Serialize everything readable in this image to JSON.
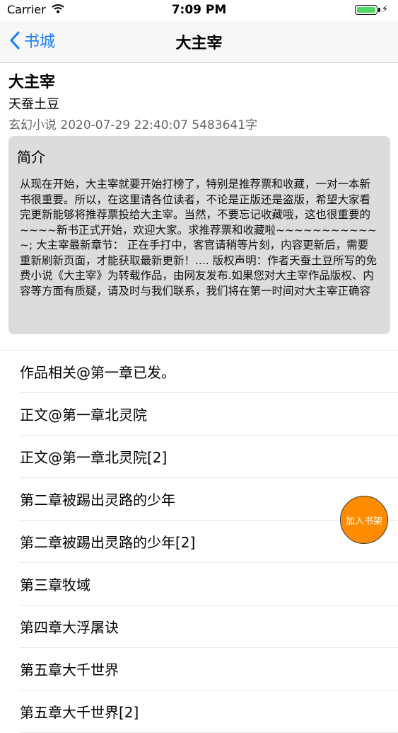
{
  "status_bar": {
    "carrier": "Carrier",
    "time": "7:09 PM",
    "battery_level": 1.0
  },
  "nav": {
    "back_label": "书城",
    "title": "大主宰"
  },
  "book": {
    "title": "大主宰",
    "author": "天蚕土豆",
    "meta": "玄幻小说 2020-07-29 22:40:07 5483641字"
  },
  "intro": {
    "heading": "简介",
    "text": "从现在开始，大主宰就要开始打榜了，特别是推荐票和收藏，一对一本新书很重要。所以，在这里请各位读者，不论是正版还是盗版，希望大家看完更新能够将推荐票投给大主宰。当然，不要忘记收藏哦，这也很重要的~~~~新书正式开始，欢迎大家。求推荐票和收藏啦~~~~~~~~~~~~; 大主宰最新章节： 正在手打中，客官请稍等片刻，内容更新后，需要重新刷新页面，才能获取最新更新！.... 版权声明：作者天蚕土豆所写的免费小说《大主宰》为转载作品，由网友发布.如果您对大主宰作品版权、内容等方面有质疑，请及时与我们联系，我们将在第一时间对大主宰正确容"
  },
  "chapters": [
    "作品相关@第一章已发。",
    "正文@第一章北灵院",
    "正文@第一章北灵院[2]",
    "第二章被踢出灵路的少年",
    "第二章被踢出灵路的少年[2]",
    "第三章牧域",
    "第四章大浮屠诀",
    "第五章大千世界",
    "第五章大千世界[2]"
  ],
  "fab": {
    "label": "加入书架"
  },
  "colors": {
    "accent": "#147efb",
    "fab": "#ff8c00",
    "intro_bg": "#dcdcdc"
  }
}
